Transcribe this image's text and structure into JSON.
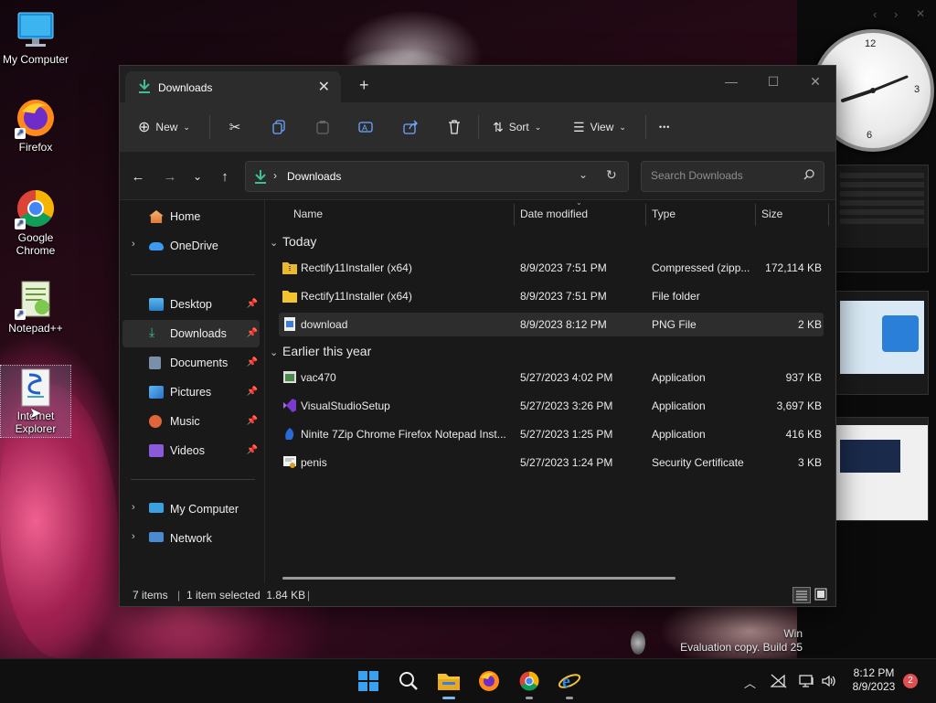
{
  "desktop": {
    "icons": [
      {
        "label": "My Computer",
        "icon": "monitor-icon"
      },
      {
        "label": "Firefox",
        "icon": "firefox-icon"
      },
      {
        "label": "Google Chrome",
        "icon": "chrome-icon"
      },
      {
        "label": "Notepad++",
        "icon": "notepad-plus-plus-icon"
      },
      {
        "label": "Internet Explorer",
        "icon": "internet-explorer-setup-icon"
      }
    ],
    "watermark_line1": "Win",
    "watermark_line2": "Evaluation copy. Build 25"
  },
  "clock": {
    "n12": "12",
    "n3": "3",
    "n6": "6"
  },
  "window": {
    "tab_title": "Downloads",
    "new_tab": "+",
    "toolbar": {
      "new_label": "New",
      "sort_label": "Sort",
      "view_label": "View",
      "more_label": "•••"
    },
    "address": {
      "path": "Downloads"
    },
    "search": {
      "placeholder": "Search Downloads"
    },
    "nav": {
      "home": "Home",
      "onedrive": "OneDrive",
      "desktop": "Desktop",
      "downloads": "Downloads",
      "documents": "Documents",
      "pictures": "Pictures",
      "music": "Music",
      "videos": "Videos",
      "my_computer": "My Computer",
      "network": "Network"
    },
    "columns": {
      "name": "Name",
      "date": "Date modified",
      "type": "Type",
      "size": "Size"
    },
    "groups": [
      {
        "title": "Today",
        "files": [
          {
            "name": "Rectify11Installer (x64)",
            "date": "8/9/2023 7:51 PM",
            "type": "Compressed (zipp...",
            "size": "172,114 KB",
            "icon": "zip-folder-icon"
          },
          {
            "name": "Rectify11Installer (x64)",
            "date": "8/9/2023 7:51 PM",
            "type": "File folder",
            "size": "",
            "icon": "folder-icon"
          },
          {
            "name": "download",
            "date": "8/9/2023 8:12 PM",
            "type": "PNG File",
            "size": "2 KB",
            "icon": "png-file-icon"
          }
        ]
      },
      {
        "title": "Earlier this year",
        "files": [
          {
            "name": "vac470",
            "date": "5/27/2023 4:02 PM",
            "type": "Application",
            "size": "937 KB",
            "icon": "app-icon"
          },
          {
            "name": "VisualStudioSetup",
            "date": "5/27/2023 3:26 PM",
            "type": "Application",
            "size": "3,697 KB",
            "icon": "visual-studio-icon"
          },
          {
            "name": "Ninite 7Zip Chrome Firefox Notepad Inst...",
            "date": "5/27/2023 1:25 PM",
            "type": "Application",
            "size": "416 KB",
            "icon": "ninite-icon"
          },
          {
            "name": "penis",
            "date": "5/27/2023 1:24 PM",
            "type": "Security Certificate",
            "size": "3 KB",
            "icon": "certificate-icon"
          }
        ]
      }
    ],
    "status": {
      "items": "7 items",
      "selected": "1 item selected  1.84 KB"
    }
  },
  "taskbar": {
    "time": "8:12 PM",
    "date": "8/9/2023",
    "notifications": "2"
  }
}
